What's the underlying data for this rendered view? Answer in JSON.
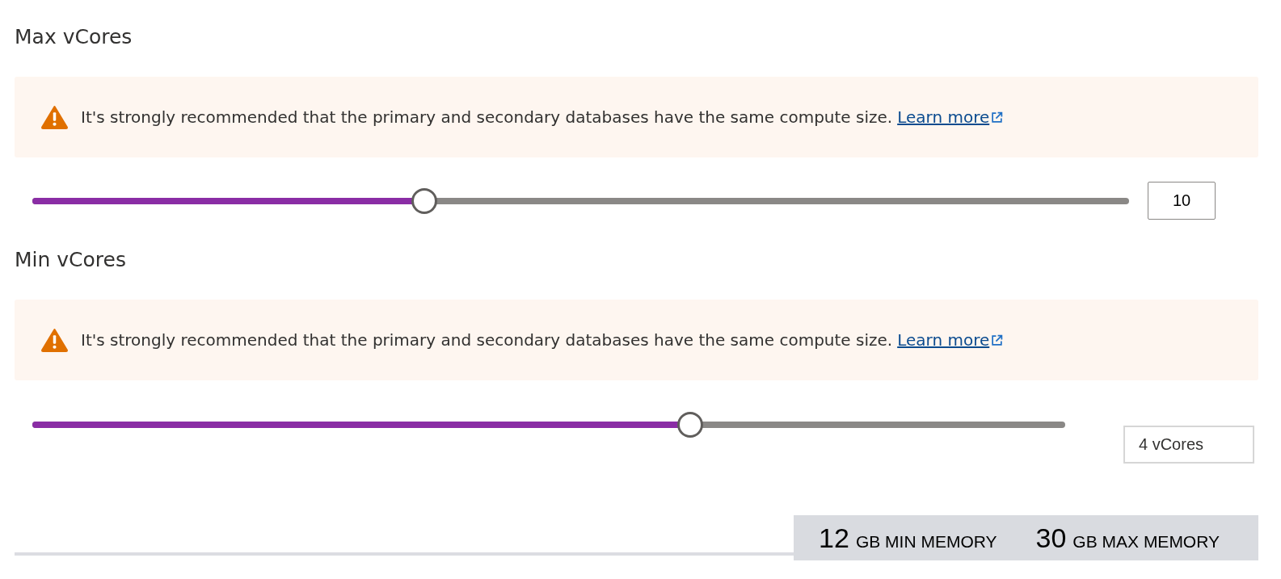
{
  "sections": [
    {
      "heading": "Max vCores",
      "warning": {
        "text": "It's strongly recommended that the primary and secondary databases have the same compute size.",
        "link": "Learn more"
      },
      "slider": {
        "level": 0.357
      },
      "value": {
        "text": "10",
        "kind": "number"
      }
    },
    {
      "heading": "Min vCores",
      "warning": {
        "text": "It's strongly recommended that the primary and secondary databases have the same compute size.",
        "link": "Learn more"
      },
      "slider": {
        "level": 0.636
      },
      "value": {
        "text": "4 vCores",
        "kind": "dropdown"
      }
    }
  ],
  "memory": [
    {
      "amount": "12",
      "label": "GB MIN MEMORY"
    },
    {
      "amount": "30",
      "label": "GB MAX MEMORY"
    }
  ]
}
